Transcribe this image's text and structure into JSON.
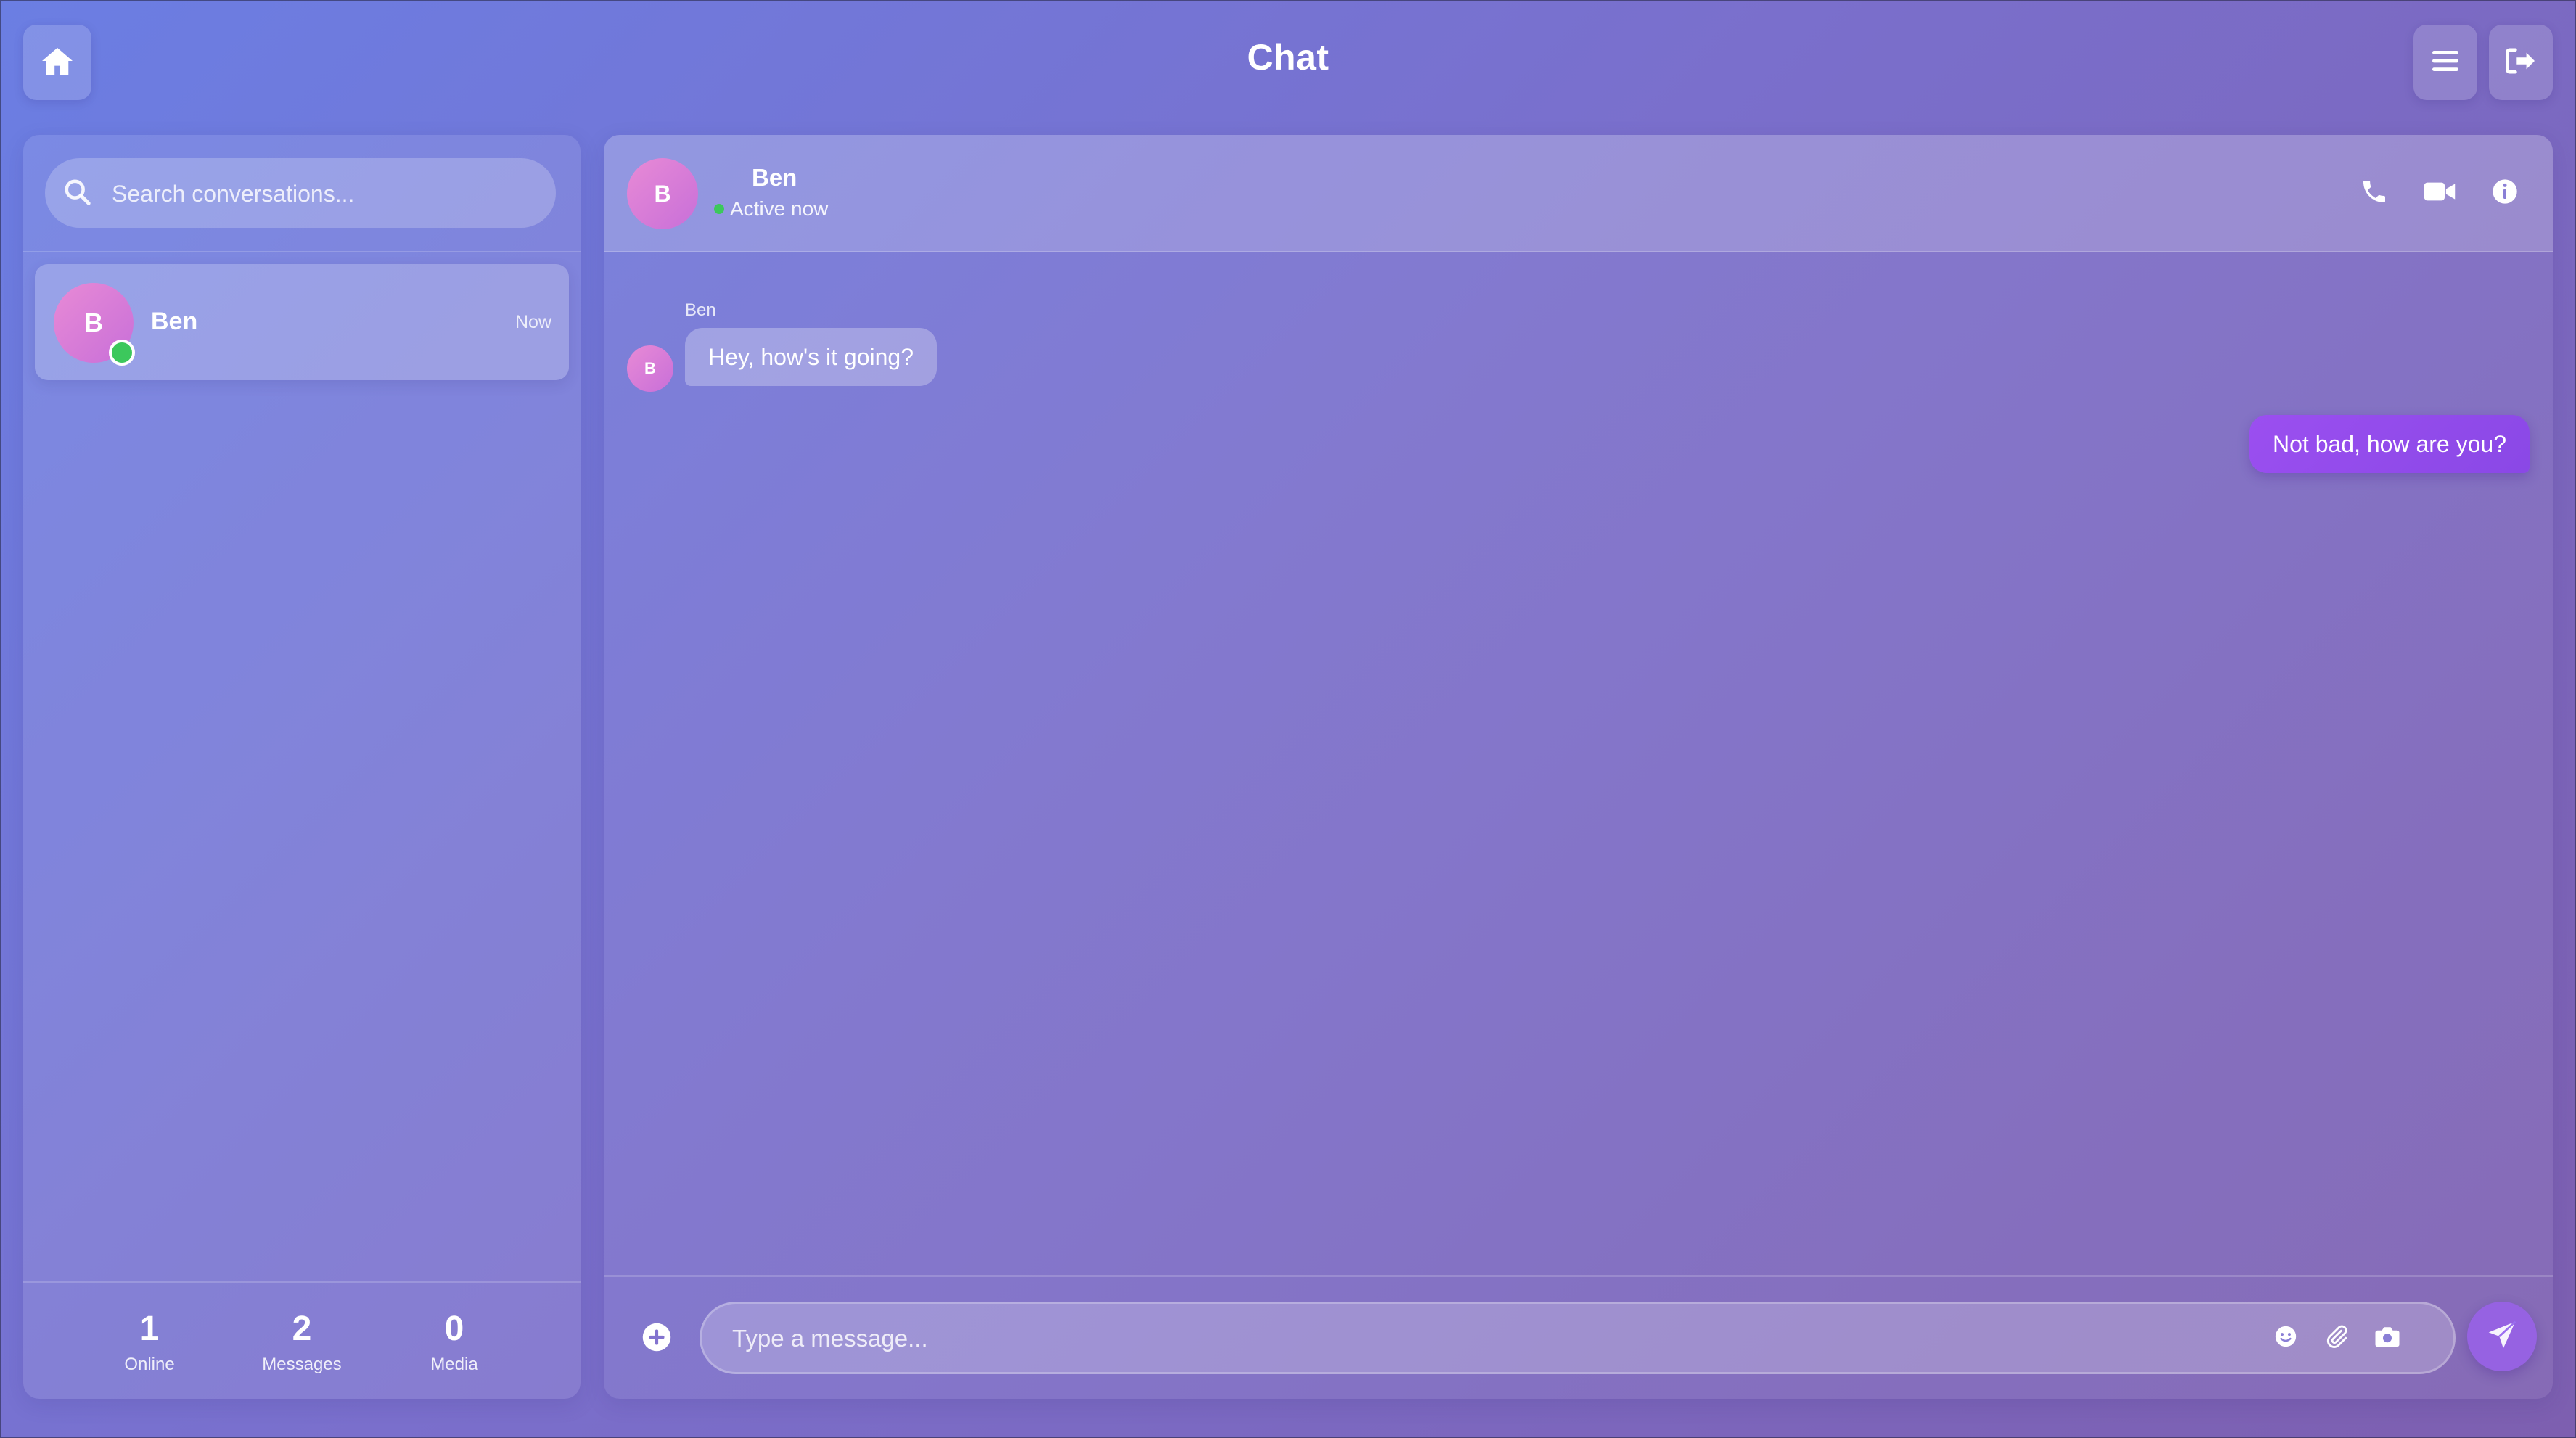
{
  "header": {
    "title": "Chat",
    "home_icon": "home-icon",
    "menu_icon": "menu-icon",
    "logout_icon": "logout-icon"
  },
  "sidebar": {
    "search": {
      "placeholder": "Search conversations...",
      "value": "",
      "icon": "search-icon"
    },
    "conversations": [
      {
        "avatar_initial": "B",
        "name": "Ben",
        "time": "Now",
        "online": true,
        "selected": true
      }
    ],
    "stats": [
      {
        "value": "1",
        "label": "Online"
      },
      {
        "value": "2",
        "label": "Messages"
      },
      {
        "value": "0",
        "label": "Media"
      }
    ]
  },
  "chat": {
    "contact": {
      "avatar_initial": "B",
      "name": "Ben",
      "status": "Active now"
    },
    "header_icons": [
      "phone-icon",
      "video-icon",
      "info-icon"
    ],
    "messages": [
      {
        "direction": "incoming",
        "sender": "Ben",
        "avatar_initial": "B",
        "text": "Hey, how's it going?"
      },
      {
        "direction": "outgoing",
        "text": "Not bad, how are you?"
      }
    ],
    "composer": {
      "placeholder": "Type a message...",
      "value": "",
      "icons": [
        "add-icon",
        "emoji-icon",
        "attach-icon",
        "camera-icon",
        "send-icon"
      ]
    }
  },
  "colors": {
    "background_start": "#6b7ee3",
    "background_end": "#7d5fb0",
    "outgoing_bubble": "#9b4ff0",
    "online_green": "#3cc85c",
    "avatar_pink": "#e88ad6"
  }
}
